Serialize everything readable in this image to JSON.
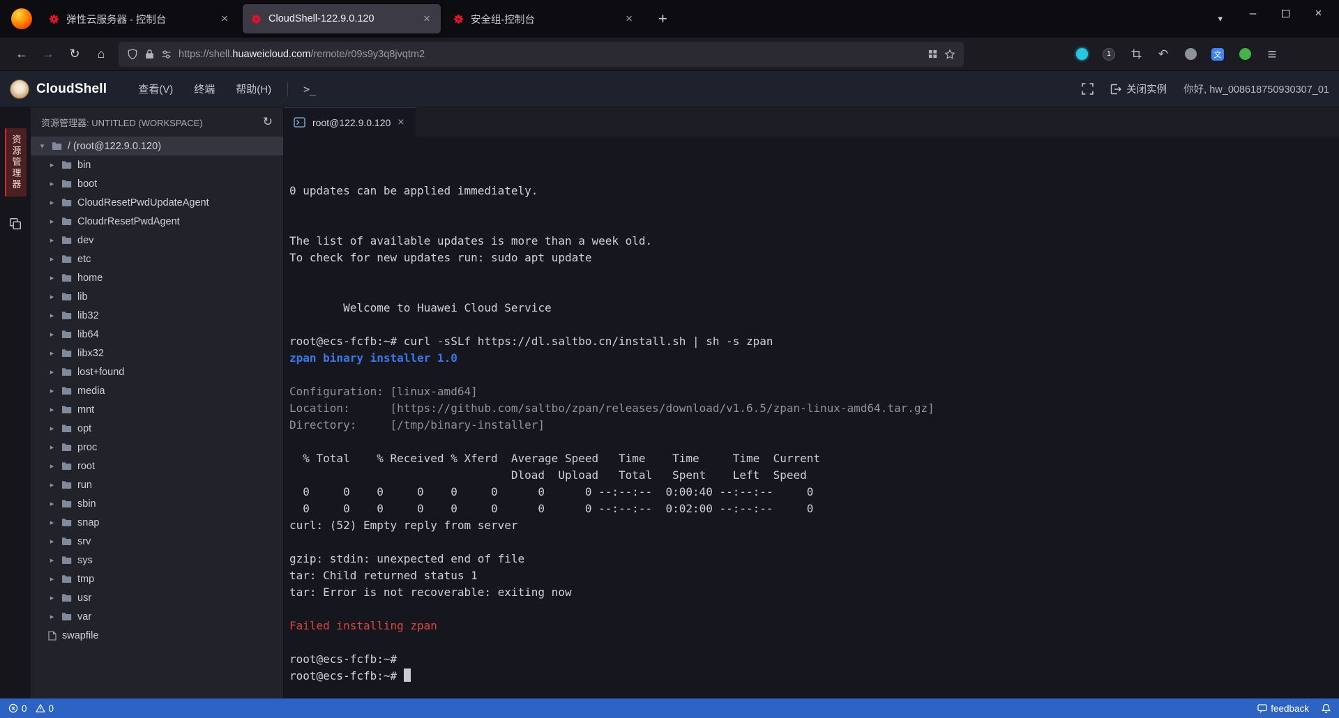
{
  "browser": {
    "tabs": [
      {
        "title": "弹性云服务器 - 控制台",
        "active": false
      },
      {
        "title": "CloudShell-122.9.0.120",
        "active": true
      },
      {
        "title": "安全组-控制台",
        "active": false
      }
    ],
    "new_tab_label": "+",
    "url": {
      "scheme_sub": "https://shell.",
      "domain": "huaweicloud.com",
      "path": "/remote/r09s9y3q8jvqtm2"
    },
    "shield_badge": "1",
    "translate_glyph": "文"
  },
  "app_header": {
    "title": "CloudShell",
    "menu": [
      {
        "label": "查看(V)"
      },
      {
        "label": "终端"
      },
      {
        "label": "帮助(H)"
      }
    ],
    "prompt_glyph": ">_",
    "close_instance_label": "关闭实例",
    "greeting": "你好, hw_008618750930307_01"
  },
  "activity_bar": {
    "explorer_label": "资源管理器"
  },
  "sidebar": {
    "header": "资源管理器: UNTITLED (WORKSPACE)",
    "root_item": "/ (root@122.9.0.120)",
    "folders": [
      "bin",
      "boot",
      "CloudResetPwdUpdateAgent",
      "CloudrResetPwdAgent",
      "dev",
      "etc",
      "home",
      "lib",
      "lib32",
      "lib64",
      "libx32",
      "lost+found",
      "media",
      "mnt",
      "opt",
      "proc",
      "root",
      "run",
      "sbin",
      "snap",
      "srv",
      "sys",
      "tmp",
      "usr",
      "var"
    ],
    "files": [
      "swapfile"
    ]
  },
  "terminal": {
    "tab_label": "root@122.9.0.120",
    "lines": [
      {
        "t": "",
        "c": ""
      },
      {
        "t": "",
        "c": ""
      },
      {
        "t": "0 updates can be applied immediately.",
        "c": ""
      },
      {
        "t": "",
        "c": ""
      },
      {
        "t": "",
        "c": ""
      },
      {
        "t": "The list of available updates is more than a week old.",
        "c": ""
      },
      {
        "t": "To check for new updates run: sudo apt update",
        "c": ""
      },
      {
        "t": "",
        "c": ""
      },
      {
        "t": "",
        "c": ""
      },
      {
        "t": "        Welcome to Huawei Cloud Service",
        "c": ""
      },
      {
        "t": "",
        "c": ""
      },
      {
        "t": "root@ecs-fcfb:~# curl -sSLf https://dl.saltbo.cn/install.sh | sh -s zpan",
        "c": ""
      },
      {
        "t": "zpan binary installer 1.0",
        "c": "blue"
      },
      {
        "t": "",
        "c": ""
      },
      {
        "t": "Configuration: [linux-amd64]",
        "c": "dim"
      },
      {
        "t": "Location:      [https://github.com/saltbo/zpan/releases/download/v1.6.5/zpan-linux-amd64.tar.gz]",
        "c": "dim"
      },
      {
        "t": "Directory:     [/tmp/binary-installer]",
        "c": "dim"
      },
      {
        "t": "",
        "c": ""
      },
      {
        "t": "  % Total    % Received % Xferd  Average Speed   Time    Time     Time  Current",
        "c": ""
      },
      {
        "t": "                                 Dload  Upload   Total   Spent    Left  Speed",
        "c": ""
      },
      {
        "t": "  0     0    0     0    0     0      0      0 --:--:--  0:00:40 --:--:--     0",
        "c": ""
      },
      {
        "t": "  0     0    0     0    0     0      0      0 --:--:--  0:02:00 --:--:--     0",
        "c": ""
      },
      {
        "t": "curl: (52) Empty reply from server",
        "c": ""
      },
      {
        "t": "",
        "c": ""
      },
      {
        "t": "gzip: stdin: unexpected end of file",
        "c": ""
      },
      {
        "t": "tar: Child returned status 1",
        "c": ""
      },
      {
        "t": "tar: Error is not recoverable: exiting now",
        "c": ""
      },
      {
        "t": "",
        "c": ""
      },
      {
        "t": "Failed installing zpan",
        "c": "red"
      },
      {
        "t": "",
        "c": ""
      },
      {
        "t": "root@ecs-fcfb:~# ",
        "c": ""
      },
      {
        "t": "root@ecs-fcfb:~# ",
        "c": "cursor"
      }
    ]
  },
  "status_bar": {
    "error_count": "0",
    "warning_count": "0",
    "feedback_label": "feedback"
  },
  "colors": {
    "installer_blue": "#3a78e8",
    "error_red": "#d8453e",
    "status_bar_blue": "#2d63c2",
    "huawei_red": "#e2132b",
    "terminal_bg": "#16161e"
  }
}
